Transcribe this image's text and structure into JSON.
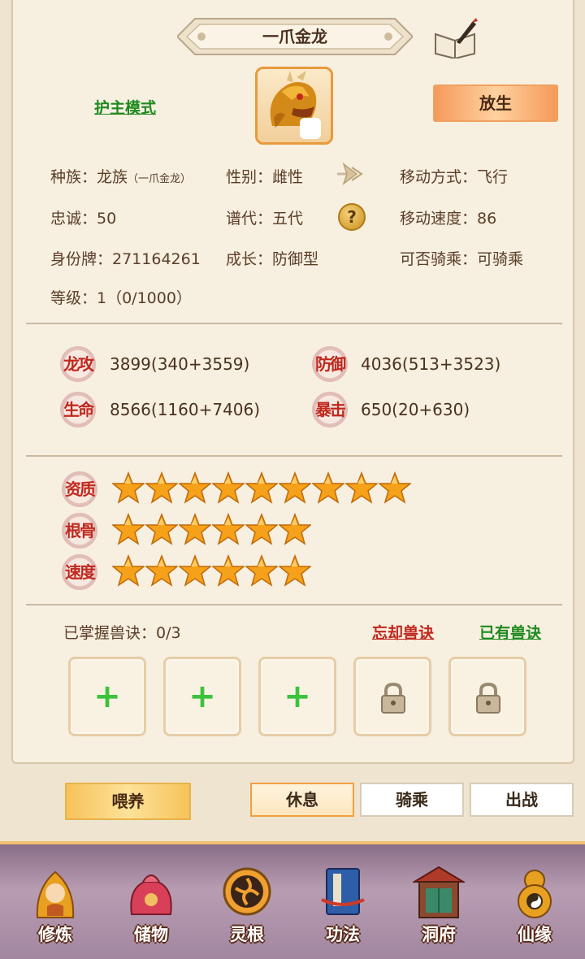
{
  "header": {
    "title": "一爪金龙",
    "book_icon": "book-quill-icon"
  },
  "actions": {
    "guard_mode": "护主模式",
    "release": "放生"
  },
  "portrait": {
    "icon": "golden-dragon-avatar"
  },
  "info": {
    "race_label": "种族：",
    "race_value": "龙族",
    "race_sub": "（一爪金龙）",
    "gender": "性别：雌性",
    "move_mode": "移动方式：飞行",
    "loyalty": "忠诚：50",
    "generation": "谱代：五代",
    "move_speed": "移动速度：86",
    "id_tag": "身份牌：271164261",
    "growth": "成长：防御型",
    "rideable": "可否骑乘：可骑乘",
    "level": "等级：1（0/1000）"
  },
  "stats": [
    {
      "label": "龙攻",
      "value": "3899(340+3559)"
    },
    {
      "label": "防御",
      "value": "4036(513+3523)"
    },
    {
      "label": "生命",
      "value": "8566(1160+7406)"
    },
    {
      "label": "暴击",
      "value": "650(20+630)"
    }
  ],
  "ratings": [
    {
      "label": "资质",
      "stars": 9
    },
    {
      "label": "根骨",
      "stars": 6
    },
    {
      "label": "速度",
      "stars": 6
    }
  ],
  "skills": {
    "mastered": "已掌握兽诀：0/3",
    "forget_link": "忘却兽诀",
    "owned_link": "已有兽诀",
    "slots": [
      "add",
      "add",
      "add",
      "locked",
      "locked"
    ]
  },
  "bottom_actions": {
    "feed": "喂养",
    "rest": "休息",
    "ride": "骑乘",
    "battle": "出战"
  },
  "nav": [
    {
      "label": "修炼",
      "icon": "cultivation-icon"
    },
    {
      "label": "储物",
      "icon": "storage-bag-icon"
    },
    {
      "label": "灵根",
      "icon": "spirit-root-icon"
    },
    {
      "label": "功法",
      "icon": "scripture-book-icon"
    },
    {
      "label": "洞府",
      "icon": "cave-mansion-icon"
    },
    {
      "label": "仙缘",
      "icon": "gourd-icon"
    }
  ],
  "colors": {
    "accent_orange": "#f0a040",
    "link_green": "#1e8a1e",
    "link_red": "#c0281e",
    "star_gold": "#f6a11a"
  }
}
